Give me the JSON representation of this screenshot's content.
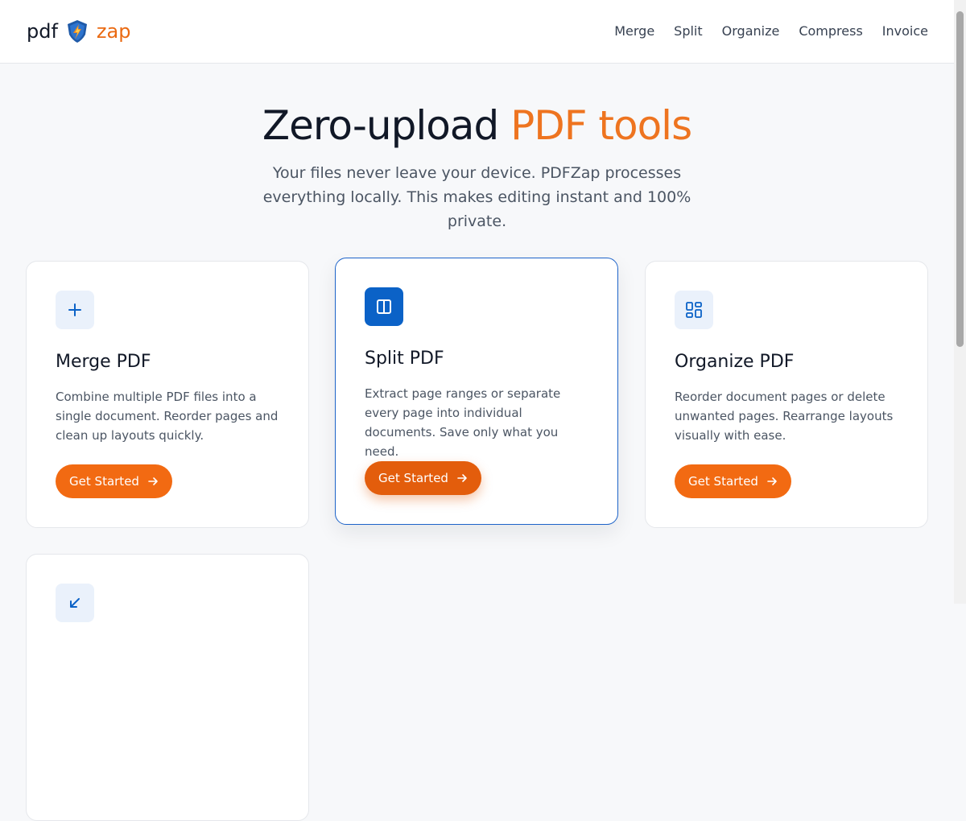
{
  "header": {
    "logo": {
      "part1": "pdf",
      "part2": "zap",
      "icon": "flame-shield-icon"
    },
    "nav": [
      "Merge",
      "Split",
      "Organize",
      "Compress",
      "Invoice"
    ]
  },
  "hero": {
    "title_main": "Zero-upload",
    "title_accent": "PDF tools",
    "subtitle": "Your files never leave your device. PDFZap processes everything locally. This makes editing instant and 100% private."
  },
  "cards": [
    {
      "icon": "plus-icon",
      "title": "Merge PDF",
      "description": "Combine multiple PDF files into a single document. Reorder pages and clean up layouts quickly.",
      "button": "Get Started"
    },
    {
      "icon": "columns-icon",
      "title": "Split PDF",
      "description": "Extract page ranges or separate every page into individual documents. Save only what you need.",
      "button": "Get Started"
    },
    {
      "icon": "grid-icon",
      "title": "Organize PDF",
      "description": "Reorder document pages or delete unwanted pages. Rearrange layouts visually with ease.",
      "button": "Get Started"
    },
    {
      "icon": "compress-arrow-icon"
    }
  ],
  "colors": {
    "accent": "#ee7420",
    "button": "#f26a12",
    "primary_blue": "#0b62c7"
  }
}
